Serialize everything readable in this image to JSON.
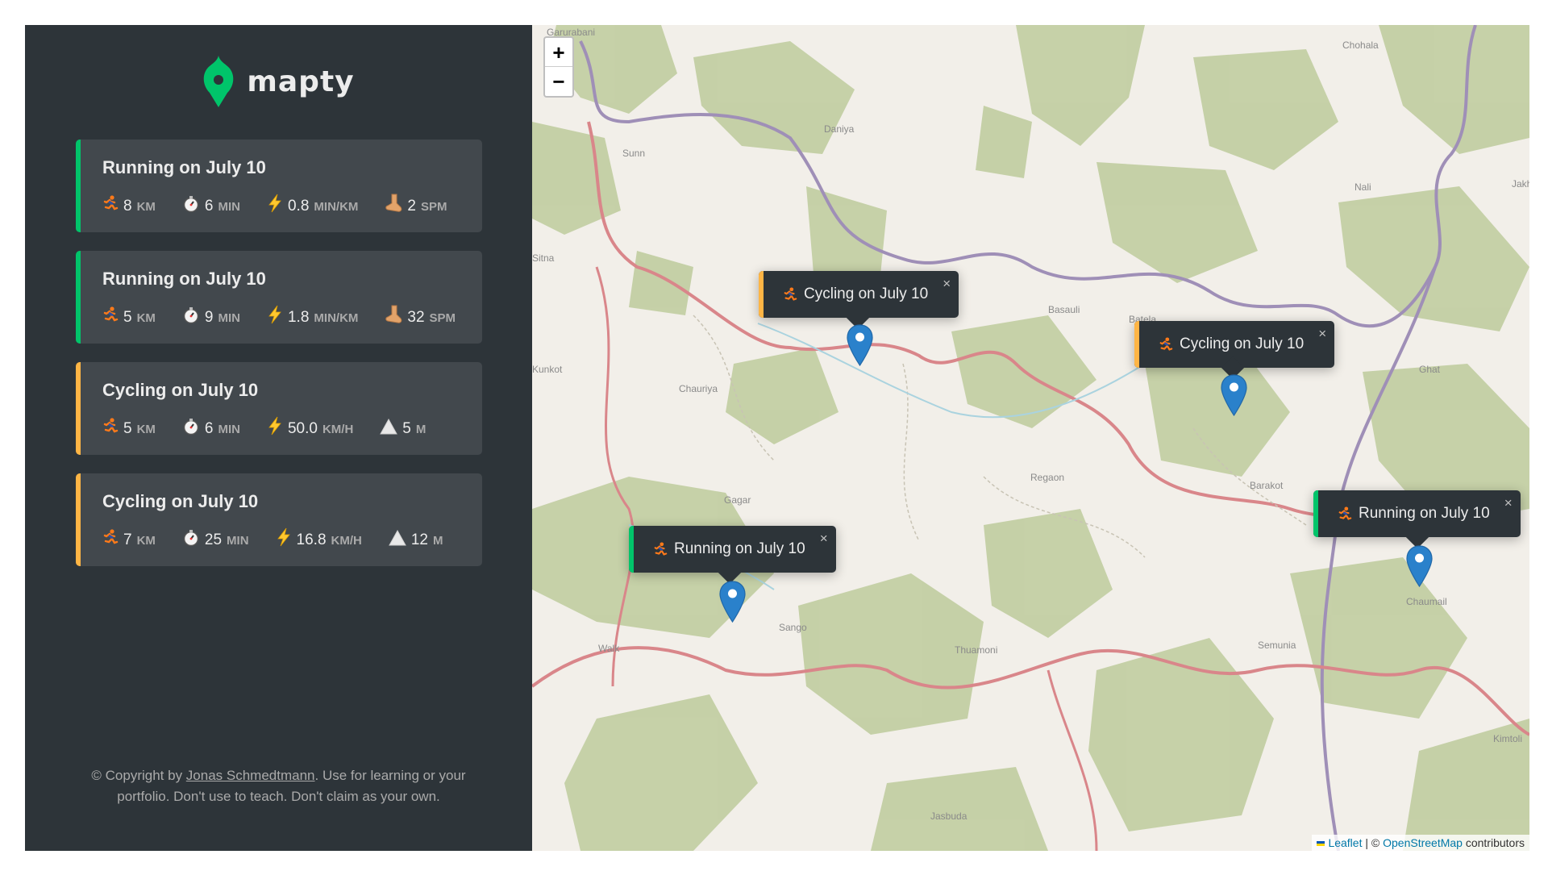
{
  "brand": {
    "name": "mapty",
    "color": "#00c46a"
  },
  "workouts": [
    {
      "type": "running",
      "title": "Running on July 10",
      "distance": "8",
      "distance_unit": "km",
      "duration": "6",
      "duration_unit": "min",
      "pace": "0.8",
      "pace_unit": "min/km",
      "cadence": "2",
      "cadence_unit": "spm"
    },
    {
      "type": "running",
      "title": "Running on July 10",
      "distance": "5",
      "distance_unit": "km",
      "duration": "9",
      "duration_unit": "min",
      "pace": "1.8",
      "pace_unit": "min/km",
      "cadence": "32",
      "cadence_unit": "spm"
    },
    {
      "type": "cycling",
      "title": "Cycling on July 10",
      "distance": "5",
      "distance_unit": "km",
      "duration": "6",
      "duration_unit": "min",
      "speed": "50.0",
      "speed_unit": "km/h",
      "elevation": "5",
      "elevation_unit": "m"
    },
    {
      "type": "cycling",
      "title": "Cycling on July 10",
      "distance": "7",
      "distance_unit": "km",
      "duration": "25",
      "duration_unit": "min",
      "speed": "16.8",
      "speed_unit": "km/h",
      "elevation": "12",
      "elevation_unit": "m"
    }
  ],
  "copyright": {
    "prefix": "© Copyright by ",
    "author": "Jonas Schmedtmann",
    "suffix": ". Use for learning or your portfolio. Don't use to teach. Don't claim as your own."
  },
  "map": {
    "zoom_in": "+",
    "zoom_out": "−",
    "popups": [
      {
        "type": "cycling",
        "text": "Cycling on July 10",
        "close": "×"
      },
      {
        "type": "cycling",
        "text": "Cycling on July 10",
        "close": "×"
      },
      {
        "type": "running",
        "text": "Running on July 10",
        "close": "×"
      },
      {
        "type": "running",
        "text": "Running on July 10",
        "close": "×"
      }
    ],
    "place_labels": [
      "Garurabani",
      "Sunn",
      "Daniya",
      "Chohala",
      "Nali",
      "Jakh",
      "Kunkot",
      "Chauriya",
      "Basauli",
      "Batela",
      "Ghat",
      "Gagar",
      "Regaon",
      "Barakot",
      "Chaumail",
      "Sango",
      "Walk",
      "Thuamoni",
      "Semunia",
      "Kimtoli",
      "Jasbuda",
      "Sitna"
    ],
    "attribution": {
      "leaflet": "Leaflet",
      "sep": " | © ",
      "osm": "OpenStreetMap",
      "suffix": " contributors"
    }
  },
  "colors": {
    "running": "#00c46a",
    "cycling": "#ffb545",
    "sidebar": "#2d3439",
    "card": "#42484d",
    "marker": "#2a81cb"
  }
}
